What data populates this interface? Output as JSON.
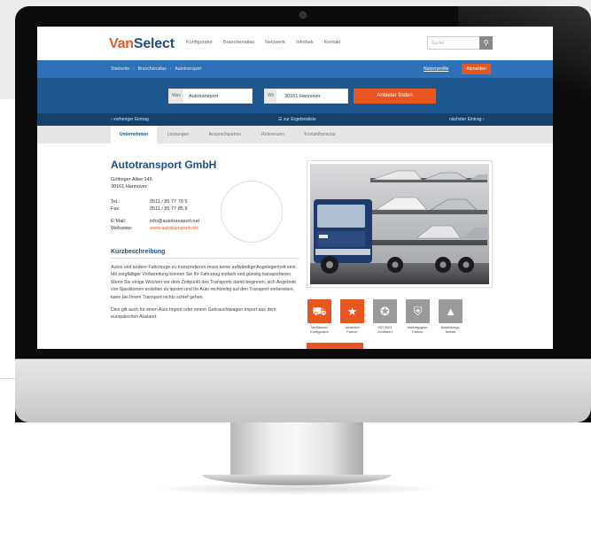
{
  "brand": {
    "part1": "Van",
    "part2": "Select"
  },
  "nav": [
    "Konfigurator",
    "Branchenatlas",
    "Netzwerk",
    "Infothek",
    "Kontakt"
  ],
  "search": {
    "placeholder": "Suche",
    "icon": "search-icon"
  },
  "breadcrumb": {
    "items": [
      "Startseite",
      "Branchenatlas",
      "Autotransport"
    ],
    "sep": "›"
  },
  "account": {
    "profile_link": "Nutzerprofile",
    "logout": "Abmelden"
  },
  "search_form": {
    "what_prefix": "Was",
    "what_value": "Autotransport",
    "where_prefix": "Wo",
    "where_value": "30161 Hannover",
    "submit": "Anbieter finden"
  },
  "pager": {
    "prev": "vorheriger Eintrag",
    "list": "zur Ergebnisliste",
    "next": "nächster Eintrag"
  },
  "tabs": [
    "Unternehmen",
    "Leistungen",
    "Ansprechpartner",
    "Referenzen",
    "Kontaktformular"
  ],
  "company": {
    "name": "Autotransport GmbH",
    "street": "Göttinger Allee 145",
    "city": "30161 Hannover",
    "tel_label": "Tel.:",
    "tel": "0511 / 85 77 70 5",
    "fax_label": "Fax:",
    "fax": "0511 / 85 77 85 9",
    "email_label": "E-Mail:",
    "email": "info@autotransport.net",
    "website_label": "Webseite:",
    "website": "www.autotransport.net"
  },
  "description": {
    "heading": "Kurzbeschreibung",
    "p1": "Autos und andere Fahrzeuge zu transportieren muss keine aufwändige Angelegenheit sein. Mit sorgfältiger Vorbereitung können Sie Ihr Fahrzeug einfach und günstig transportieren. Wenn Sie einige Wochen vor dem Zeitpunkt des Transports damit beginnen, sich Angebote von Speditionen erstellen zu lassen und Ihr Auto rechtzeitig auf den Transport vorbereiten, kann bei Ihrem Transport nichts schief gehen.",
    "p2": "Dies gilt auch für einen Auto Import oder einem Gebrauchtwagen Import aus dem europäischen Ausland."
  },
  "badges": [
    {
      "icon": "truck-icon",
      "caption": "Verifizierter Konfigurator",
      "color": "#e8561f"
    },
    {
      "icon": "star-icon",
      "caption": "Vanselect Partner",
      "color": "#e8561f"
    },
    {
      "icon": "award-icon",
      "caption": "ISO 9001 Zertifiziert",
      "color": "#9a9a9a"
    },
    {
      "icon": "shield-icon",
      "caption": "Haftungsgepr. Partner",
      "color": "#9a9a9a"
    },
    {
      "icon": "graduation-cap-icon",
      "caption": "Ausbildungs-betrieb",
      "color": "#9a9a9a"
    }
  ],
  "colors": {
    "accent": "#e8561f",
    "brand_blue": "#1f4f82",
    "bar_blue": "#2d72b8",
    "dark_blue": "#1e578f"
  }
}
